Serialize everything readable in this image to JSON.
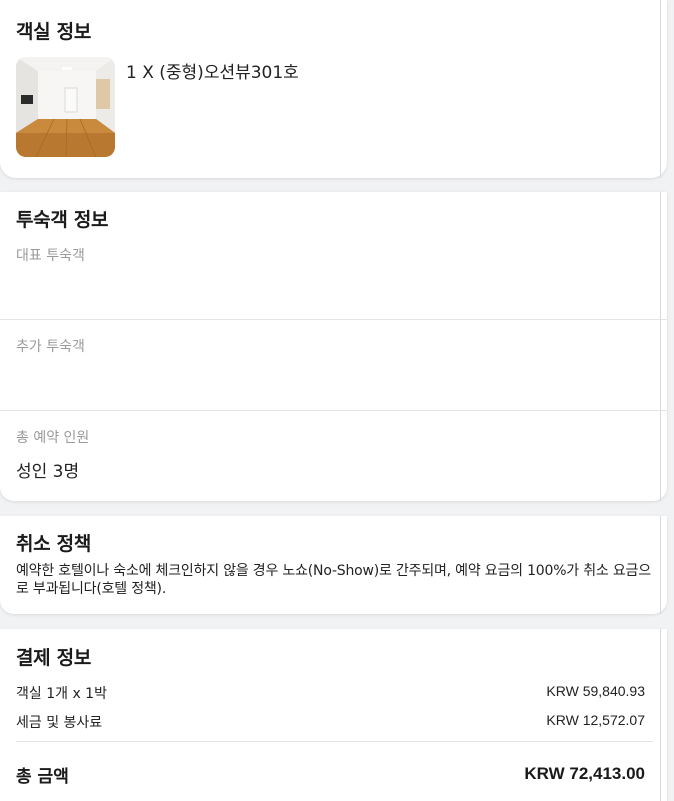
{
  "room": {
    "title": "객실 정보",
    "name": "1 X (중형)오션뷰301호"
  },
  "guest": {
    "title": "투숙객 정보",
    "primary_label": "대표 투숙객",
    "additional_label": "추가 투숙객",
    "total_label": "총 예약 인원",
    "total_value": "성인 3명"
  },
  "cancel": {
    "title": "취소 정책",
    "policy": "예약한 호텔이나 숙소에 체크인하지 않을 경우 노쇼(No-Show)로 간주되며, 예약 요금의 100%가 취소 요금으로 부과됩니다(호텔 정책)."
  },
  "payment": {
    "title": "결제 정보",
    "rows": [
      {
        "label": "객실 1개 x 1박",
        "value": "KRW 59,840.93"
      },
      {
        "label": "세금 및 봉사료",
        "value": "KRW 12,572.07"
      }
    ],
    "total_label": "총 금액",
    "total_value": "KRW 72,413.00"
  }
}
